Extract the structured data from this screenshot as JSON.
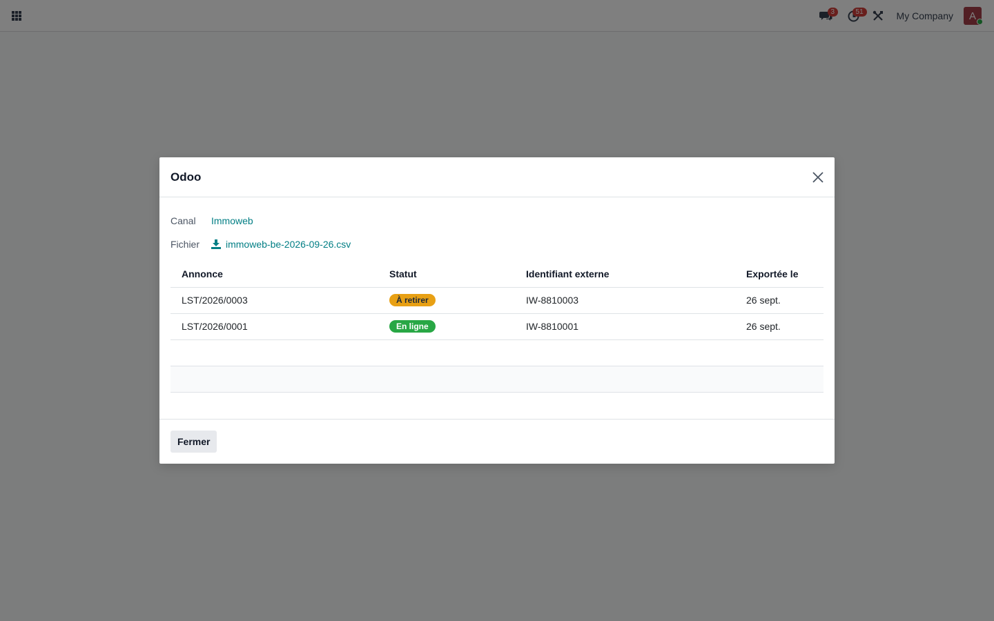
{
  "navbar": {
    "messages_badge": "3",
    "activities_badge": "51",
    "company_name": "My Company",
    "avatar_initial": "A"
  },
  "modal": {
    "title": "Odoo",
    "canal_label": "Canal",
    "canal_value": "Immoweb",
    "fichier_label": "Fichier",
    "fichier_value": "immoweb-be-2026-09-26.csv",
    "table": {
      "headers": [
        "Annonce",
        "Statut",
        "Identifiant externe",
        "Exportée le"
      ],
      "rows": [
        {
          "annonce": "LST/2026/0003",
          "statut": "À retirer",
          "identifiant": "IW-8810003",
          "exportee": "26 sept."
        },
        {
          "annonce": "LST/2026/0001",
          "statut": "En ligne",
          "identifiant": "IW-8810001",
          "exportee": "26 sept."
        }
      ]
    },
    "footer": {
      "close_label": "Fermer"
    }
  },
  "colors": {
    "accent": "#017e84",
    "status_warning": "#e8a014",
    "status_success": "#28a745",
    "badge": "#d23f3a",
    "avatar": "#a53f48"
  },
  "icons": {
    "apps": "apps-grid-icon",
    "messages": "chat-bubbles-icon",
    "activities": "clock-icon",
    "debug": "tools-icon",
    "close": "close-icon",
    "download": "download-icon"
  }
}
